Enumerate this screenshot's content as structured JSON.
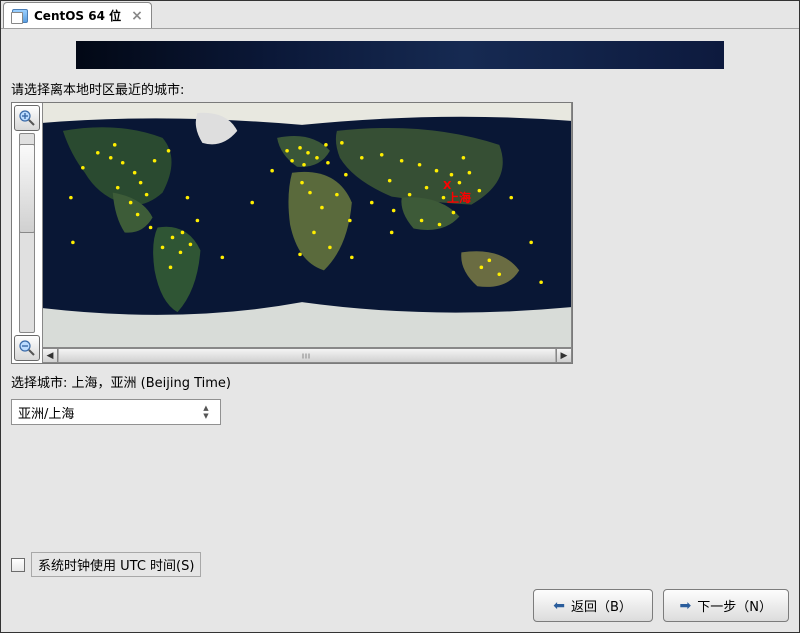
{
  "tab": {
    "title": "CentOS 64 位",
    "close": "×"
  },
  "page": {
    "prompt": "请选择离本地时区最近的城市:",
    "selected_prefix": "选择城市: ",
    "selected_value": "上海，亚洲 (Beijing Time)"
  },
  "dropdown": {
    "value": "亚洲/上海"
  },
  "map": {
    "marker_label": "上海",
    "marker_x": "X"
  },
  "utc": {
    "label": "系统时钟使用 UTC 时间(S)",
    "checked": false
  },
  "buttons": {
    "back": "返回（B）",
    "next": "下一步（N）"
  },
  "icons": {
    "back_arrow": "⬅",
    "next_arrow": "➡",
    "up": "▲",
    "down": "▼",
    "left": "◀",
    "right": "▶"
  }
}
